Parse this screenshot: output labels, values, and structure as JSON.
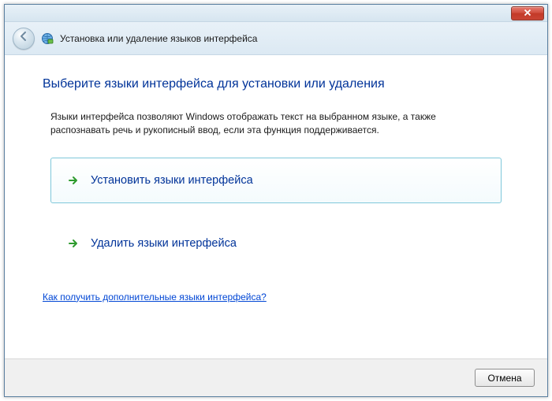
{
  "header": {
    "title": "Установка или удаление языков интерфейса"
  },
  "page": {
    "title": "Выберите языки интерфейса для установки или удаления",
    "description": "Языки интерфейса позволяют Windows отображать текст на выбранном языке, а также распознавать речь и рукописный ввод, если эта функция поддерживается."
  },
  "options": {
    "install": "Установить языки интерфейса",
    "remove": "Удалить языки интерфейса"
  },
  "help_link": "Как получить дополнительные языки интерфейса?",
  "footer": {
    "cancel": "Отмена"
  }
}
